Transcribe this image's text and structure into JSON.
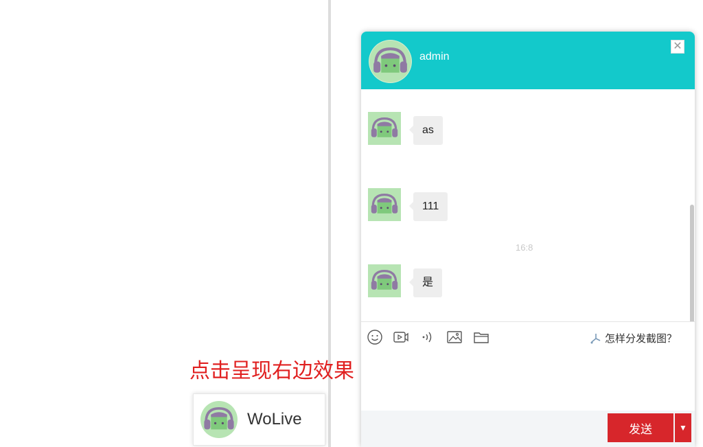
{
  "hint_text": "点击呈现右边效果",
  "launcher": {
    "label": "WoLive"
  },
  "chat": {
    "title": "admin",
    "close_glyph": "✕",
    "messages": [
      {
        "text": "as"
      },
      {
        "text": "111"
      },
      {
        "text": "是"
      }
    ],
    "timestamp": "16:8",
    "toolbar": {
      "icons": [
        "emoji-icon",
        "video-icon",
        "voice-icon",
        "image-icon",
        "folder-icon"
      ],
      "screenshot_tip": "怎样分发截图？"
    },
    "send_label": "发送",
    "send_dropdown_glyph": "▼"
  },
  "colors": {
    "header": "#13c9cb",
    "send": "#d7262b",
    "hint": "#e02020",
    "avatar_bg": "#b7e4b3",
    "avatar_fg": "#8f7aa3",
    "avatar_face": "#7fc97c"
  }
}
